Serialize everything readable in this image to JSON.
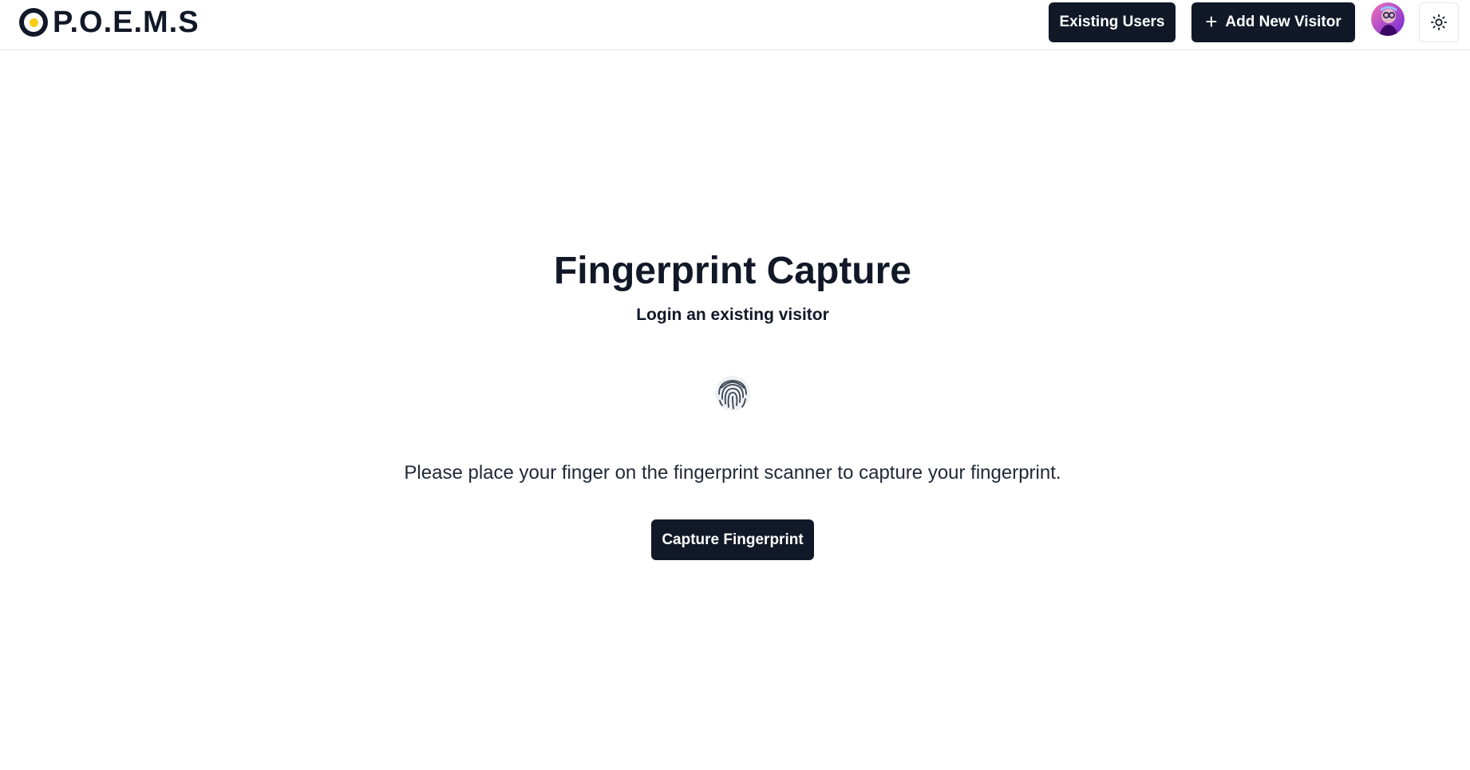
{
  "header": {
    "logo_text": "P.O.E.M.S",
    "existing_users_label": "Existing Users",
    "add_visitor_label": "Add New Visitor",
    "add_icon": "plus-icon",
    "avatar_icon": "user-avatar",
    "theme_icon": "sun-icon"
  },
  "main": {
    "title": "Fingerprint Capture",
    "subtitle": "Login an existing visitor",
    "fingerprint_icon": "fingerprint-icon",
    "instruction": "Please place your finger on the fingerprint scanner to capture your fingerprint.",
    "capture_button_label": "Capture Fingerprint"
  },
  "colors": {
    "primary": "#111827",
    "logo_accent": "#facc15",
    "border": "#e5e7eb",
    "background": "#ffffff"
  }
}
